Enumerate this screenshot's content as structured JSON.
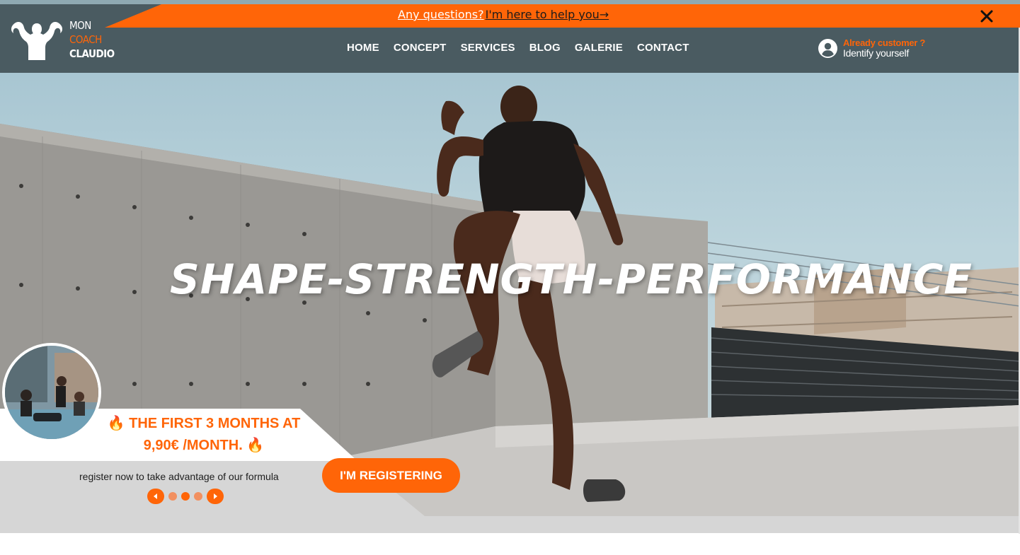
{
  "announcement": {
    "question": "Any questions?",
    "help_link": "I'm here to help you→",
    "close_icon": "close-icon"
  },
  "logo": {
    "line1": "MON",
    "line2": "COACH",
    "line3": "CLAUDIO",
    "icon": "bodybuilder-logo-icon"
  },
  "nav": {
    "items": [
      {
        "label": "HOME"
      },
      {
        "label": "CONCEPT"
      },
      {
        "label": "SERVICES"
      },
      {
        "label": "BLOG"
      },
      {
        "label": "GALERIE"
      },
      {
        "label": "CONTACT"
      }
    ]
  },
  "account": {
    "line1": "Already customer ?",
    "line2": "Identify yourself",
    "icon": "user-circle-icon"
  },
  "hero": {
    "title": "SHAPE-STRENGTH-PERFORMANCE"
  },
  "promo": {
    "headline_line1": "THE FIRST 3 MONTHS AT",
    "headline_line2": "9,90€ /MONTH.",
    "fire_icon": "🔥",
    "subtitle": "register now to take advantage of our formula",
    "cta_label": "I'M REGISTERING",
    "slider": {
      "dot_count": 3,
      "active_index": 1
    }
  },
  "colors": {
    "accent": "#ff6508",
    "header_bg": "#4a5b61",
    "band_grey": "#d6d6d6"
  }
}
